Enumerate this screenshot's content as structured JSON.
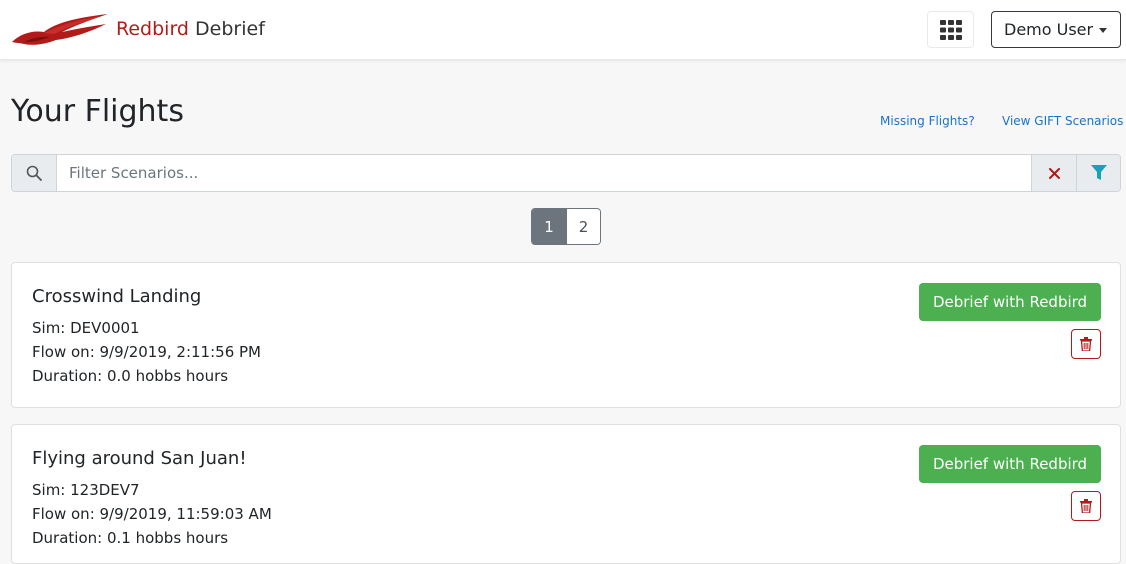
{
  "header": {
    "brand_part1": "Redbird",
    "brand_part2": "Debrief",
    "apps_icon": "grid-icon",
    "user_menu_label": "Demo User"
  },
  "page": {
    "title": "Your Flights",
    "missing_flights_link": "Missing Flights?",
    "gift_link": "View GIFT Scenarios"
  },
  "filter": {
    "placeholder": "Filter Scenarios...",
    "value": ""
  },
  "pagination": {
    "pages": [
      "1",
      "2"
    ],
    "current": "1"
  },
  "flights": [
    {
      "title": "Crosswind Landing",
      "sim": "Sim: DEV0001",
      "flown": "Flow on: 9/9/2019, 2:11:56 PM",
      "duration": "Duration: 0.0 hobbs hours",
      "debrief_label": "Debrief with Redbird"
    },
    {
      "title": "Flying around San Juan!",
      "sim": "Sim: 123DEV7",
      "flown": "Flow on: 9/9/2019, 11:59:03 AM",
      "duration": "Duration: 0.1 hobbs hours",
      "debrief_label": "Debrief with Redbird"
    }
  ],
  "colors": {
    "brand_red": "#b31b1b",
    "link_blue": "#1a73c9",
    "success_green": "#4caf50",
    "filter_teal": "#17a2b8",
    "secondary_gray": "#6c757d"
  }
}
